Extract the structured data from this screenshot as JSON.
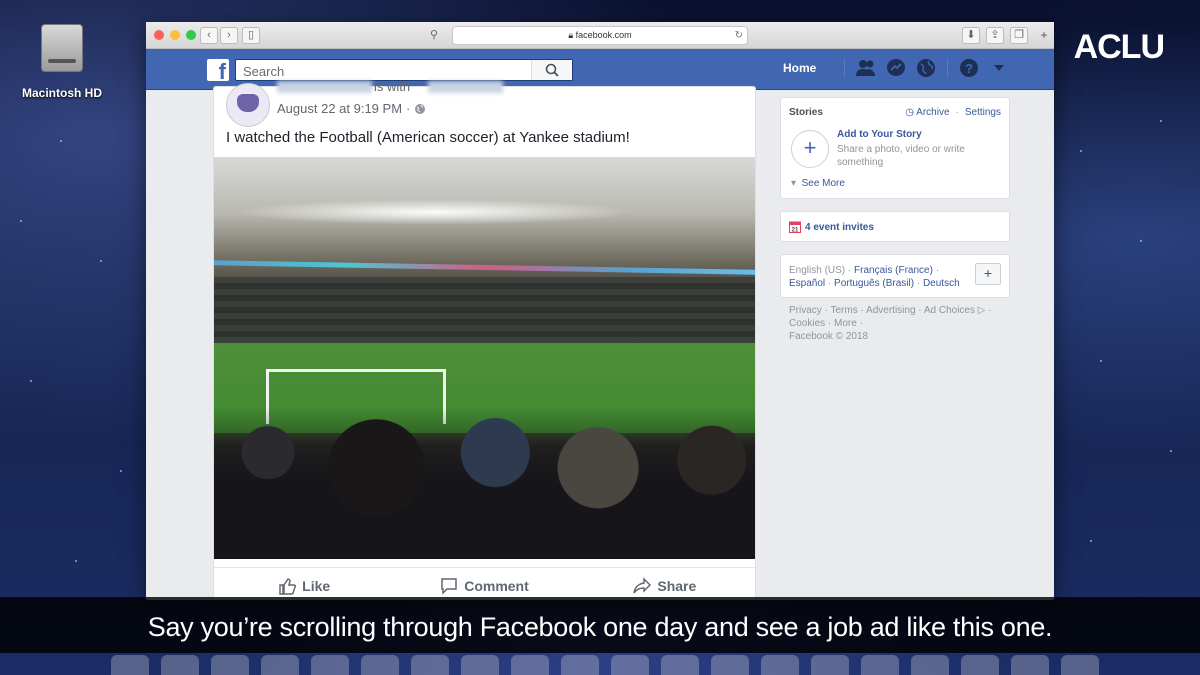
{
  "desktop": {
    "drive_label": "Macintosh HD",
    "watermark": "ACLU"
  },
  "browser": {
    "url": "facebook.com"
  },
  "facebook": {
    "search_placeholder": "Search",
    "home_label": "Home",
    "brand_color": "#4267b2",
    "post": {
      "with_text": "is with",
      "timestamp": "August 22 at 9:19 PM",
      "separator": "·",
      "text": "I watched the Football (American soccer) at Yankee stadium!",
      "actions": {
        "like": "Like",
        "comment": "Comment",
        "share": "Share"
      }
    },
    "stories": {
      "title": "Stories",
      "archive": "Archive",
      "link_sep": "·",
      "settings": "Settings",
      "add_title": "Add to Your Story",
      "add_desc": "Share a photo, video or write something",
      "see_more": "See More"
    },
    "events": {
      "label": "4 event invites",
      "date_num": "21"
    },
    "languages": {
      "current": "English (US)",
      "sep": " · ",
      "options": [
        "Français (France)",
        "Español",
        "Português (Brasil)",
        "Deutsch"
      ]
    },
    "footer": {
      "line1": "Privacy · Terms · Advertising · Ad Choices ▷ ·",
      "line2": "Cookies · More ·",
      "copyright": "Facebook © 2018"
    }
  },
  "caption": "Say you’re scrolling through Facebook one day and see a job ad like this one."
}
